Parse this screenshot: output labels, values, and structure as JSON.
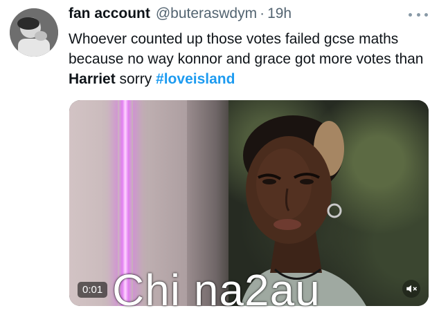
{
  "tweet": {
    "display_name": "fan account",
    "handle": "@buteraswdym",
    "separator": "·",
    "time": "19h",
    "text_part1": "Whoever counted up those votes failed gcse maths because no way konnor and grace got more votes than ",
    "text_bold": "Harriet",
    "text_part2": " sorry ",
    "hashtag": "#loveisland"
  },
  "icons": {
    "more": "more-horizontal-icon",
    "mute": "volume-muted-icon"
  },
  "media": {
    "type": "video",
    "timestamp": "0:01"
  },
  "watermark": "Chi na2au",
  "colors": {
    "text": "#0f1419",
    "secondary": "#536471",
    "link": "#1d9bf0"
  }
}
